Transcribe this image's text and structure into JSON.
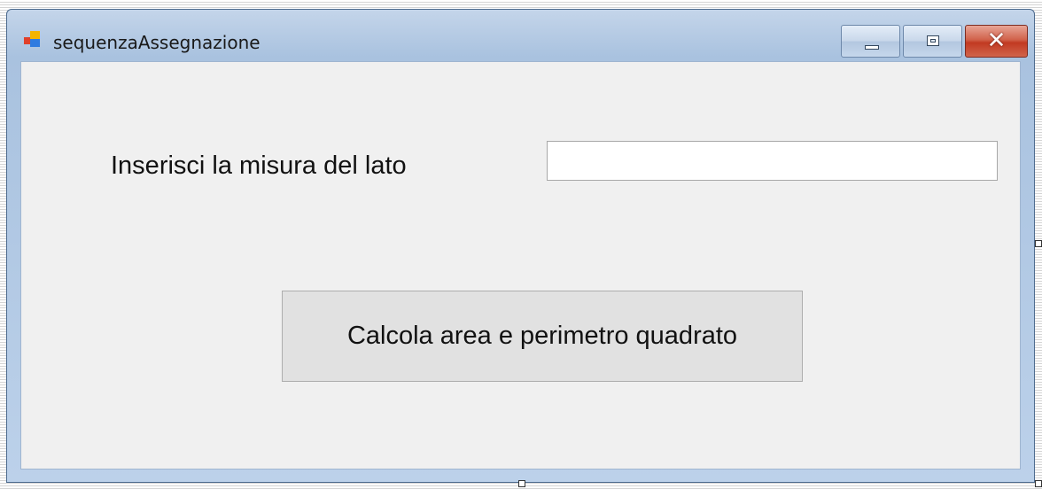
{
  "window": {
    "title": "sequenzaAssegnazione",
    "icon": "winforms-app-icon",
    "controls": {
      "minimize_icon": "minimize-icon",
      "maximize_icon": "maximize-icon",
      "close_icon": "close-icon",
      "close_glyph": "✕"
    }
  },
  "form": {
    "side_label": "Inserisci la misura del lato",
    "side_input_value": "",
    "calculate_button": "Calcola area e perimetro quadrato"
  },
  "colors": {
    "client_background": "#f0f0f0",
    "button_background": "#e1e1e1",
    "close_button": "#c23a22",
    "title_bar": "#a9c2df"
  }
}
